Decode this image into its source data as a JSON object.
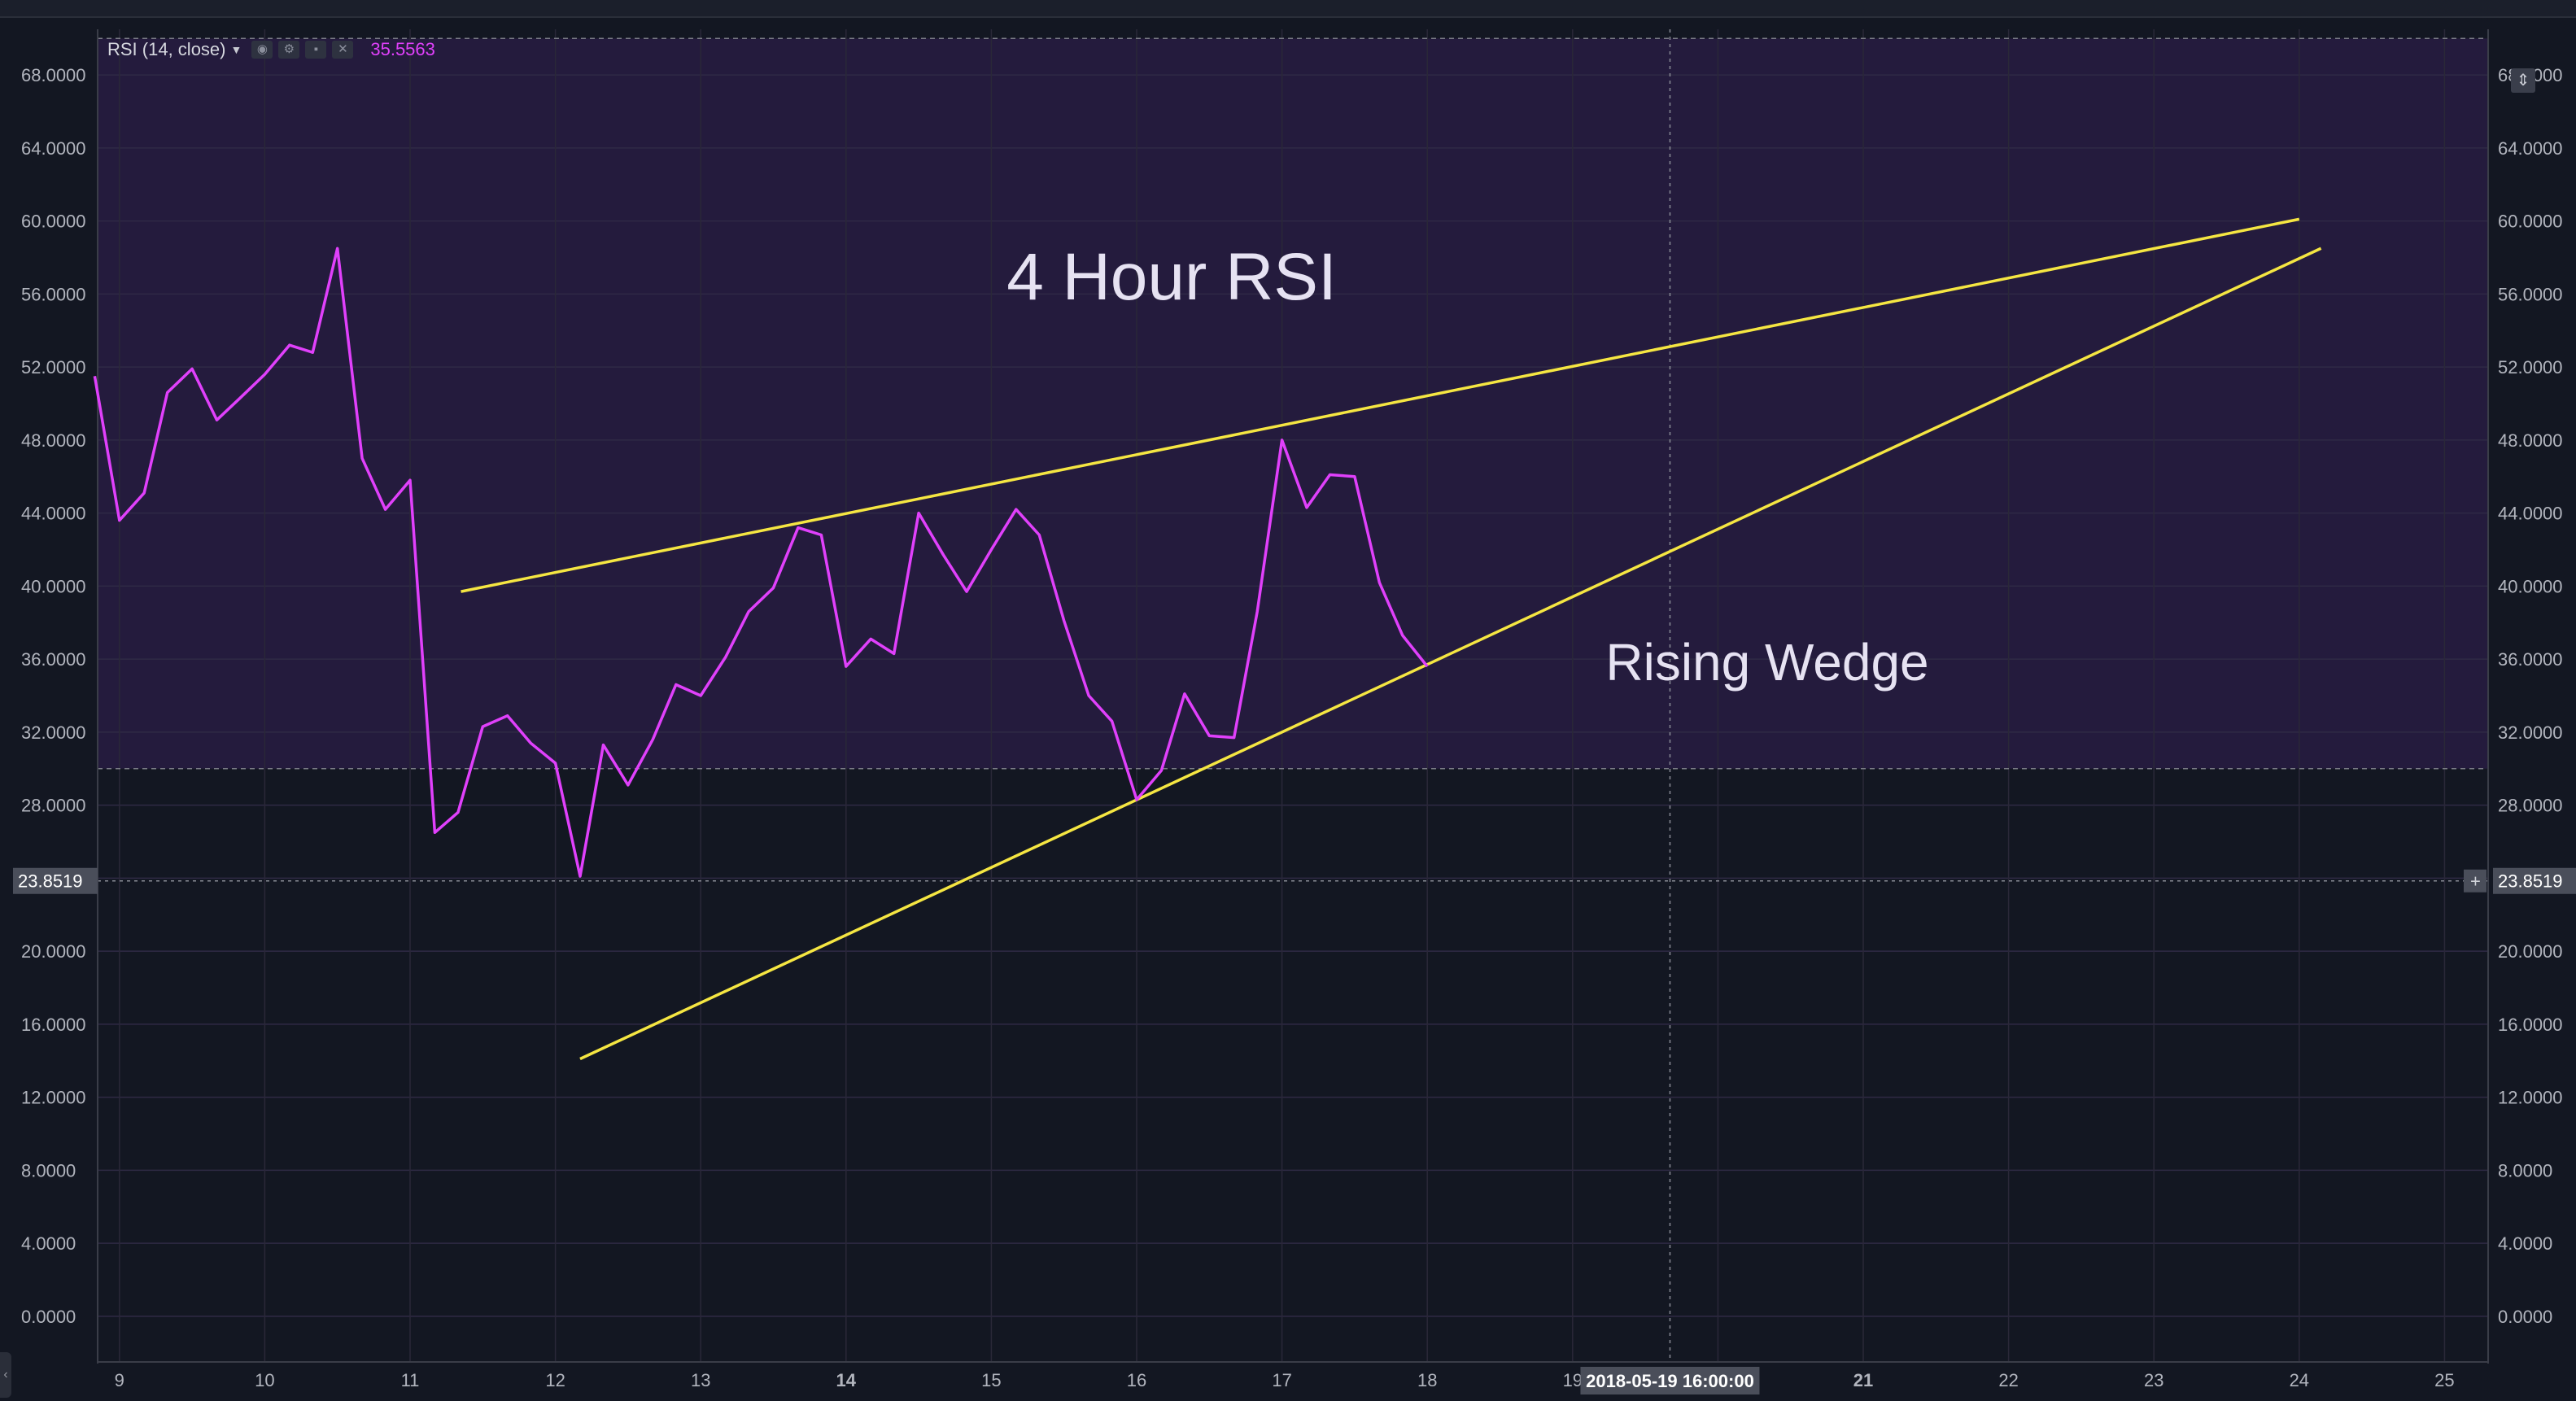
{
  "indicator": {
    "label": "RSI (14, close)",
    "current_value": "35.5563",
    "color": "#e040fb"
  },
  "annotations": {
    "title": "4 Hour RSI",
    "pattern": "Rising Wedge",
    "trendline_color": "#f5e642"
  },
  "crosshair": {
    "date_label": "2018-05-19 16:00:00",
    "price_label": "23.8519"
  },
  "chart_data": {
    "type": "line",
    "y_range": [
      -2.5,
      70.5
    ],
    "y_ticks": [
      "68.0000",
      "64.0000",
      "60.0000",
      "56.0000",
      "52.0000",
      "48.0000",
      "44.0000",
      "40.0000",
      "36.0000",
      "32.0000",
      "28.0000",
      "20.0000",
      "16.0000",
      "12.0000",
      "8.0000",
      "4.0000",
      "0.0000"
    ],
    "x_range": [
      8.85,
      25.3
    ],
    "x_ticks": [
      {
        "day": 9,
        "label": "9"
      },
      {
        "day": 10,
        "label": "10"
      },
      {
        "day": 11,
        "label": "11"
      },
      {
        "day": 12,
        "label": "12"
      },
      {
        "day": 13,
        "label": "13"
      },
      {
        "day": 14,
        "label": "14"
      },
      {
        "day": 15,
        "label": "15"
      },
      {
        "day": 16,
        "label": "16"
      },
      {
        "day": 17,
        "label": "17"
      },
      {
        "day": 18,
        "label": "18"
      },
      {
        "day": 19,
        "label": "19"
      },
      {
        "day": 20,
        "label": "20"
      },
      {
        "day": 21,
        "label": "21"
      },
      {
        "day": 22,
        "label": "22"
      },
      {
        "day": 23,
        "label": "23"
      },
      {
        "day": 24,
        "label": "24"
      },
      {
        "day": 25,
        "label": "25"
      }
    ],
    "bands": {
      "upper": 70,
      "lower": 30
    },
    "series": [
      {
        "values": [
          {
            "x": 8.83,
            "y": 51.5
          },
          {
            "x": 9.0,
            "y": 43.6
          },
          {
            "x": 9.17,
            "y": 45.1
          },
          {
            "x": 9.33,
            "y": 50.6
          },
          {
            "x": 9.5,
            "y": 51.9
          },
          {
            "x": 9.67,
            "y": 49.1
          },
          {
            "x": 9.83,
            "y": 50.3
          },
          {
            "x": 10.0,
            "y": 51.6
          },
          {
            "x": 10.17,
            "y": 53.2
          },
          {
            "x": 10.33,
            "y": 52.8
          },
          {
            "x": 10.5,
            "y": 58.5
          },
          {
            "x": 10.67,
            "y": 47.0
          },
          {
            "x": 10.83,
            "y": 44.2
          },
          {
            "x": 11.0,
            "y": 45.8
          },
          {
            "x": 11.17,
            "y": 26.5
          },
          {
            "x": 11.33,
            "y": 27.6
          },
          {
            "x": 11.5,
            "y": 32.3
          },
          {
            "x": 11.67,
            "y": 32.9
          },
          {
            "x": 11.83,
            "y": 31.4
          },
          {
            "x": 12.0,
            "y": 30.3
          },
          {
            "x": 12.17,
            "y": 24.1
          },
          {
            "x": 12.33,
            "y": 31.3
          },
          {
            "x": 12.5,
            "y": 29.1
          },
          {
            "x": 12.67,
            "y": 31.6
          },
          {
            "x": 12.83,
            "y": 34.6
          },
          {
            "x": 13.0,
            "y": 34.0
          },
          {
            "x": 13.17,
            "y": 36.1
          },
          {
            "x": 13.33,
            "y": 38.6
          },
          {
            "x": 13.5,
            "y": 39.9
          },
          {
            "x": 13.67,
            "y": 43.2
          },
          {
            "x": 13.83,
            "y": 42.8
          },
          {
            "x": 14.0,
            "y": 35.6
          },
          {
            "x": 14.17,
            "y": 37.1
          },
          {
            "x": 14.33,
            "y": 36.3
          },
          {
            "x": 14.5,
            "y": 44.0
          },
          {
            "x": 14.67,
            "y": 41.7
          },
          {
            "x": 14.83,
            "y": 39.7
          },
          {
            "x": 15.0,
            "y": 42.0
          },
          {
            "x": 15.17,
            "y": 44.2
          },
          {
            "x": 15.33,
            "y": 42.8
          },
          {
            "x": 15.5,
            "y": 38.1
          },
          {
            "x": 15.67,
            "y": 34.0
          },
          {
            "x": 15.83,
            "y": 32.6
          },
          {
            "x": 16.0,
            "y": 28.3
          },
          {
            "x": 16.17,
            "y": 29.9
          },
          {
            "x": 16.33,
            "y": 34.1
          },
          {
            "x": 16.5,
            "y": 31.8
          },
          {
            "x": 16.67,
            "y": 31.7
          },
          {
            "x": 16.83,
            "y": 38.6
          },
          {
            "x": 17.0,
            "y": 48.0
          },
          {
            "x": 17.17,
            "y": 44.3
          },
          {
            "x": 17.33,
            "y": 46.1
          },
          {
            "x": 17.5,
            "y": 46.0
          },
          {
            "x": 17.67,
            "y": 40.2
          },
          {
            "x": 17.83,
            "y": 37.3
          },
          {
            "x": 18.0,
            "y": 35.6
          }
        ]
      }
    ],
    "trendlines": [
      {
        "name": "upper",
        "from": {
          "x": 11.35,
          "y": 39.7
        },
        "to": {
          "x": 24.0,
          "y": 60.1
        }
      },
      {
        "name": "lower",
        "from": {
          "x": 12.17,
          "y": 14.1
        },
        "to": {
          "x": 24.15,
          "y": 58.5
        }
      }
    ],
    "crosshair": {
      "x": 19.67,
      "y": 23.85
    }
  }
}
